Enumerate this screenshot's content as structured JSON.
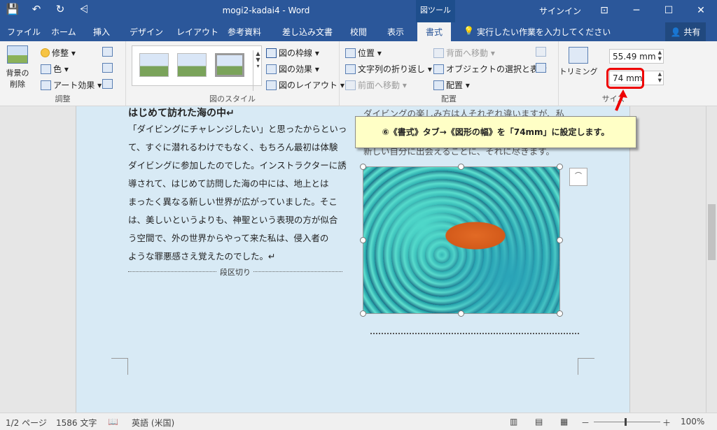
{
  "titlebar": {
    "doc_title": "mogi2-kadai4  -  Word",
    "context_tab_title": "図ツール",
    "signin": "サインイン",
    "qat": {
      "save_icon": "💾",
      "undo_icon": "↶",
      "redo_icon": "↻",
      "customize_icon": "⩤"
    },
    "controls": {
      "ribbon_display": "⊡",
      "minimize": "─",
      "maximize": "☐",
      "close": "✕"
    }
  },
  "tabs": [
    "ファイル",
    "ホーム",
    "挿入",
    "デザイン",
    "レイアウト",
    "参考資料",
    "差し込み文書",
    "校閲",
    "表示",
    "書式"
  ],
  "active_tab": "書式",
  "tellme": {
    "icon": "💡",
    "text": "実行したい作業を入力してください"
  },
  "share": {
    "icon": "👤",
    "label": "共有"
  },
  "ribbon": {
    "adjust": {
      "remove_bg": "背景の\n削除",
      "corrections": "修整 ▾",
      "color": "色 ▾",
      "artistic": "アート効果 ▾",
      "label": "調整"
    },
    "styles": {
      "border": "図の枠線 ▾",
      "effects": "図の効果 ▾",
      "layout": "図のレイアウト ▾",
      "label": "図のスタイル"
    },
    "arrange": {
      "position": "位置 ▾",
      "wrap": "文字列の折り返し ▾",
      "forward": "前面へ移動 ▾",
      "backward": "背面へ移動 ▾",
      "selection_pane": "オブジェクトの選択と表示",
      "align": "配置 ▾",
      "label": "配置"
    },
    "size": {
      "crop": "トリミング",
      "height": "55.49 mm",
      "width": "74 mm",
      "label": "サイズ"
    }
  },
  "document": {
    "heading": "はじめて訪れた海の中↵",
    "lines": [
      "「ダイビングにチャレンジしたい」と思ったからといっ",
      "て、すぐに潜れるわけでもなく、もちろん最初は体験",
      "ダイビングに参加したのでした。インストラクターに誘",
      "導されて、はじめて訪問した海の中には、地上とは",
      "まったく異なる新しい世界が広がっていました。そこ",
      "は、美しいというよりも、神聖という表現の方が似合",
      "う空間で、外の世界からやって来た私は、侵入者の",
      "ような罪悪感さえ覚えたのでした。↵"
    ],
    "section_break": "段区切り",
    "col2_top": "ダイビングの楽しみ方は人それぞれ違いますが、私",
    "col2_second": "新しい自分に出会えることに、それに尽きます。"
  },
  "callout": "⑥《書式》タブ→《図形の幅》を「74mm」に設定します。",
  "status": {
    "page": "1/2 ページ",
    "words": "1586 文字",
    "proof_icon": "📖",
    "lang": "英語 (米国)",
    "zoom": "100%",
    "view_read": "▥",
    "view_print": "▤",
    "view_web": "▦",
    "zoom_out": "－",
    "zoom_in": "＋"
  }
}
